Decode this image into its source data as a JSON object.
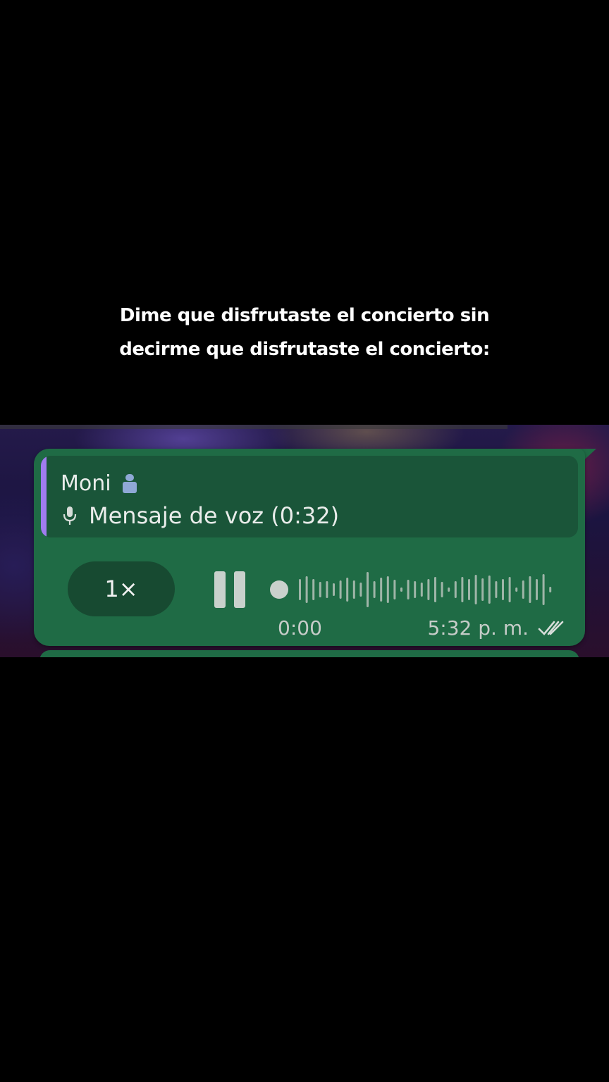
{
  "caption": {
    "line1": "Dime que disfrutaste el concierto sin",
    "line2": "decirme que disfrutaste el concierto:"
  },
  "message": {
    "quoted": {
      "sender": "Moni",
      "sender_emoji": "person-emoji-icon",
      "text": "Mensaje de voz (0:32)",
      "accent_color": "#a07cf0"
    },
    "player": {
      "speed_label": "1×",
      "elapsed": "0:00",
      "progress": 0
    },
    "timestamp": "5:32 p. m.",
    "status_icon": "double-check-icon",
    "bubble_color": "#1f6b45"
  }
}
